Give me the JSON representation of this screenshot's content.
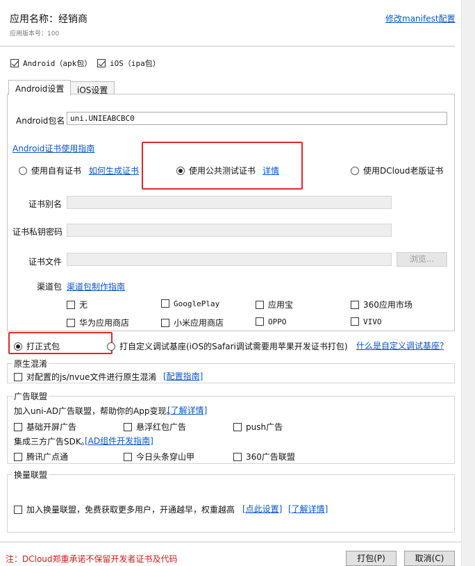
{
  "header": {
    "app_name": "应用名称：经销商",
    "version": "应用版本号：100",
    "manifest_link": "修改manifest配置"
  },
  "platforms": {
    "android": "Android（apk包）",
    "ios": "iOS（ipa包）"
  },
  "tabs": [
    "Android设置",
    "iOS设置"
  ],
  "android": {
    "package_label": "Android包名",
    "package_value": "uni.UNIEABCBC0",
    "cert_guide": "Android证书使用指南",
    "cert_options": {
      "own": "使用自有证书",
      "how_to": "如何生成证书",
      "public": "使用公共测试证书",
      "details": "详情",
      "dcloud_old": "使用DCloud老版证书"
    },
    "alias_label": "证书别名",
    "password_label": "证书私钥密码",
    "file_label": "证书文件",
    "browse": "浏览...",
    "channel_label": "渠道包",
    "channel_guide": "渠道包制作指南",
    "channels": [
      "无",
      "GooglePlay",
      "应用宝",
      "360应用市场",
      "华为应用商店",
      "小米应用商店",
      "OPPO",
      "VIVO"
    ]
  },
  "build_type": {
    "release": "打正式包",
    "custom": "打自定义调试基座(iOS的Safari调试需要用苹果开发证书打包)",
    "custom_link": "什么是自定义调试基座?"
  },
  "native_obfuscation": {
    "title": "原生混淆",
    "option": "对配置的js/nvue文件进行原生混淆",
    "guide": "[配置指南]"
  },
  "ad": {
    "title": "广告联盟",
    "intro": "加入uni-AD广告联盟，帮助你的App变现。",
    "learn_more": "[了解详情]",
    "options_row1": [
      "基础开屏广告",
      "悬浮红包广告",
      "push广告"
    ],
    "sdk_intro": "集成三方广告SDK。",
    "sdk_guide": "[AD组件开发指南]",
    "options_row2": [
      "腾讯广点通",
      "今日头条穿山甲",
      "360广告联盟"
    ]
  },
  "exchange": {
    "title": "换量联盟",
    "option": "加入换量联盟，免费获取更多用户，开通越早，权重越高",
    "settings": "[点此设置]",
    "learn_more": "[了解详情]"
  },
  "footer": {
    "note": "注：DCloud郑重承诺不保留开发者证书及代码",
    "pack": "打包(P)",
    "cancel": "取消(C)"
  },
  "colors": {
    "link": "#0a54c7",
    "highlight": "#e0262b",
    "warning": "#d11818"
  }
}
